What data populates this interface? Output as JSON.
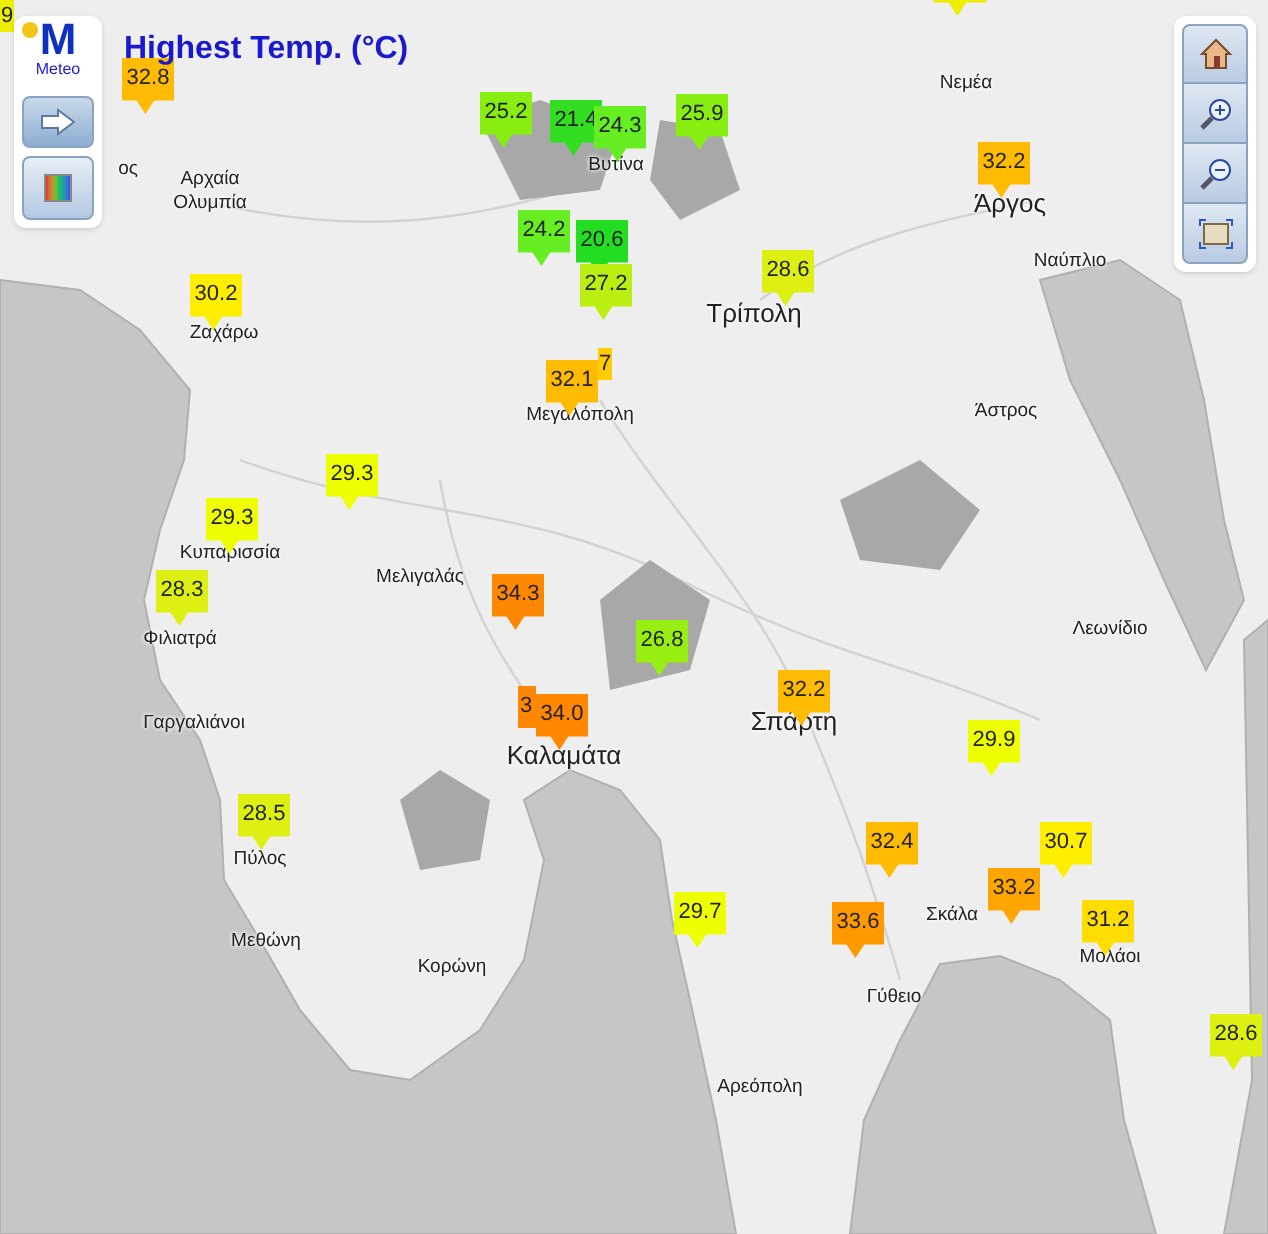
{
  "title": "Highest Temp. (°C)",
  "logo": {
    "letter": "M",
    "text": "Meteo"
  },
  "places": [
    {
      "name": "ος",
      "kind": "town"
    },
    {
      "name": "Αρχαία",
      "kind": "town"
    },
    {
      "name": "Ολυμπία",
      "kind": "town"
    },
    {
      "name": "Νεμέα",
      "kind": "town"
    },
    {
      "name": "Βυτίνα",
      "kind": "town"
    },
    {
      "name": "Άργος",
      "kind": "city"
    },
    {
      "name": "Ναύπλιο",
      "kind": "town"
    },
    {
      "name": "Ζαχάρω",
      "kind": "town"
    },
    {
      "name": "Τρίπολη",
      "kind": "city"
    },
    {
      "name": "Μεγαλόπολη",
      "kind": "town"
    },
    {
      "name": "Άστρος",
      "kind": "town"
    },
    {
      "name": "Κυπαρισσία",
      "kind": "town"
    },
    {
      "name": "Μελιγαλάς",
      "kind": "town"
    },
    {
      "name": "Φιλιατρά",
      "kind": "town"
    },
    {
      "name": "Λεωνίδιο",
      "kind": "town"
    },
    {
      "name": "Σπάρτη",
      "kind": "city"
    },
    {
      "name": "Γαργαλιάνοι",
      "kind": "town"
    },
    {
      "name": "Καλαμάτα",
      "kind": "city"
    },
    {
      "name": "Πύλος",
      "kind": "town"
    },
    {
      "name": "Σκάλα",
      "kind": "town"
    },
    {
      "name": "Μεθώνη",
      "kind": "town"
    },
    {
      "name": "Μολάοι",
      "kind": "town"
    },
    {
      "name": "Κορώνη",
      "kind": "town"
    },
    {
      "name": "Γύθειο",
      "kind": "town"
    },
    {
      "name": "Αρεόπολη",
      "kind": "town"
    }
  ],
  "markers": [
    {
      "value": "9",
      "color": "#eeee00",
      "kind": "behind-right"
    },
    {
      "color": "#eeee00",
      "kind": "full"
    },
    {
      "value": "32.8",
      "color": "#ffbb00",
      "kind": "full"
    },
    {
      "value": "25.2",
      "color": "#88ee11",
      "kind": "full"
    },
    {
      "value": "21.4",
      "color": "#33dd22",
      "kind": "full"
    },
    {
      "value": "24.3",
      "color": "#66ee22",
      "kind": "full"
    },
    {
      "value": "25.9",
      "color": "#88ee11",
      "kind": "full"
    },
    {
      "value": "32.2",
      "color": "#ffbb00",
      "kind": "full"
    },
    {
      "value": "24.2",
      "color": "#66ee22",
      "kind": "full"
    },
    {
      "value": "20.6",
      "color": "#22dd22",
      "kind": "full"
    },
    {
      "value": "27.2",
      "color": "#bbee11",
      "kind": "full"
    },
    {
      "value": "28.6",
      "color": "#ddf011",
      "kind": "full"
    },
    {
      "value": "30.2",
      "color": "#ffee00",
      "kind": "full"
    },
    {
      "value": "7",
      "color": "#ffcc00",
      "kind": "behind-right"
    },
    {
      "value": "32.1",
      "color": "#ffbb00",
      "kind": "full"
    },
    {
      "value": "29.3",
      "color": "#eeff00",
      "kind": "full"
    },
    {
      "value": "29.3",
      "color": "#eeff00",
      "kind": "full"
    },
    {
      "value": "28.3",
      "color": "#ddf011",
      "kind": "full"
    },
    {
      "value": "34.3",
      "color": "#ff8800",
      "kind": "full"
    },
    {
      "value": "26.8",
      "color": "#99ee11",
      "kind": "full"
    },
    {
      "value": "32.2",
      "color": "#ffbb00",
      "kind": "full"
    },
    {
      "value": "3",
      "color": "#ff8800",
      "kind": "behind-left"
    },
    {
      "value": "34.0",
      "color": "#ff8800",
      "kind": "full"
    },
    {
      "value": "29.9",
      "color": "#eeff00",
      "kind": "full"
    },
    {
      "value": "28.5",
      "color": "#ddf011",
      "kind": "full"
    },
    {
      "value": "32.4",
      "color": "#ffbb00",
      "kind": "full"
    },
    {
      "value": "30.7",
      "color": "#ffee00",
      "kind": "full"
    },
    {
      "value": "33.2",
      "color": "#ffa500",
      "kind": "full"
    },
    {
      "value": "31.2",
      "color": "#ffdd00",
      "kind": "full"
    },
    {
      "value": "29.7",
      "color": "#eeff00",
      "kind": "full"
    },
    {
      "value": "33.6",
      "color": "#ff9900",
      "kind": "full"
    },
    {
      "value": "28.6",
      "color": "#ddf011",
      "kind": "full"
    }
  ]
}
